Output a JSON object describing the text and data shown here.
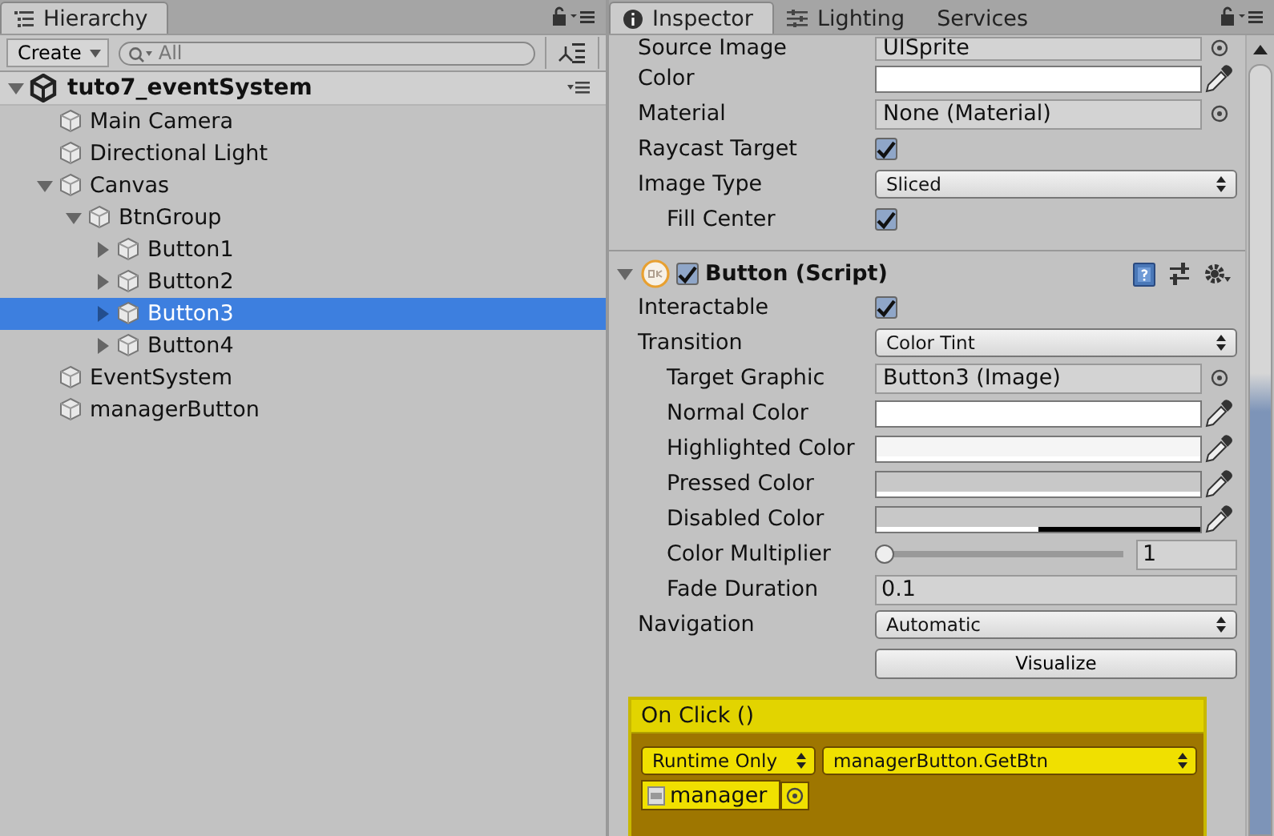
{
  "hierarchy": {
    "tab": "Hierarchy",
    "create_button": "Create",
    "search": {
      "placeholder": "All"
    },
    "scene": {
      "name": "tuto7_eventSystem",
      "expanded": true
    },
    "items": [
      {
        "name": "Main Camera",
        "foldout": false,
        "selected": false
      },
      {
        "name": "Directional Light",
        "foldout": false,
        "selected": false
      },
      {
        "name": "Canvas",
        "foldout": true,
        "expanded": true,
        "selected": false,
        "children": [
          {
            "name": "BtnGroup",
            "foldout": true,
            "expanded": true,
            "selected": false,
            "children": [
              {
                "name": "Button1",
                "foldout": true,
                "expanded": false,
                "selected": false
              },
              {
                "name": "Button2",
                "foldout": true,
                "expanded": false,
                "selected": false
              },
              {
                "name": "Button3",
                "foldout": true,
                "expanded": false,
                "selected": true
              },
              {
                "name": "Button4",
                "foldout": true,
                "expanded": false,
                "selected": false
              }
            ]
          }
        ]
      },
      {
        "name": "EventSystem",
        "foldout": false,
        "selected": false
      },
      {
        "name": "managerButton",
        "foldout": false,
        "selected": false
      }
    ]
  },
  "inspector": {
    "tabs": [
      {
        "label": "Inspector",
        "selected": true
      },
      {
        "label": "Lighting",
        "selected": false
      },
      {
        "label": "Services",
        "selected": false
      }
    ],
    "image_properties": [
      {
        "kind": "object",
        "label": "Source Image",
        "value": "UISprite"
      },
      {
        "kind": "color",
        "label": "Color",
        "color": "#ffffff",
        "level": 1
      },
      {
        "kind": "object",
        "label": "Material",
        "value": "None (Material)"
      },
      {
        "kind": "checkbox",
        "label": "Raycast Target",
        "checked": true
      },
      {
        "kind": "dropdown",
        "label": "Image Type",
        "value": "Sliced",
        "children": [
          {
            "kind": "checkbox",
            "label": "Fill Center",
            "checked": true
          }
        ]
      }
    ],
    "button_component": {
      "title": "Button (Script)",
      "enabled": true,
      "expanded": true,
      "properties": [
        {
          "kind": "checkbox",
          "label": "Interactable",
          "checked": true
        },
        {
          "kind": "dropdown",
          "label": "Transition",
          "value": "Color Tint",
          "children": [
            {
              "kind": "object",
              "label": "Target Graphic",
              "value": "Button3 (Image)"
            },
            {
              "kind": "color",
              "label": "Normal Color",
              "color": "#ffffff",
              "level": 1
            },
            {
              "kind": "color",
              "label": "Highlighted Color",
              "color": "#f5f5f5",
              "level": 1
            },
            {
              "kind": "color",
              "label": "Pressed Color",
              "color": "#c8c8c8",
              "level": 1
            },
            {
              "kind": "color",
              "label": "Disabled Color",
              "color": "#c8c8c8",
              "level": 0.5
            },
            {
              "kind": "slider",
              "label": "Color Multiplier",
              "level": 0,
              "reading": "1"
            },
            {
              "kind": "text",
              "label": "Fade Duration",
              "value": "0.1"
            }
          ]
        },
        {
          "kind": "dropdown",
          "label": "Navigation",
          "value": "Automatic"
        },
        {
          "kind": "button",
          "label": "Visualize"
        }
      ],
      "on_click": {
        "title": "On Click ()",
        "mode": "Runtime Only",
        "function": "managerButton.GetBtn",
        "object": "manager"
      }
    }
  }
}
